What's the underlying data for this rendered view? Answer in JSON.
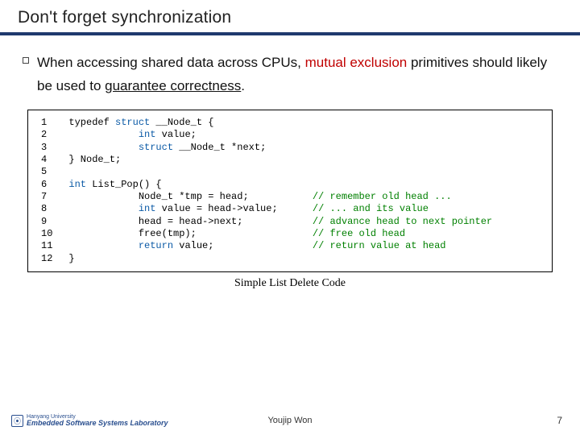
{
  "title": "Don't forget synchronization",
  "body": {
    "pre": "When accessing shared data across CPUs, ",
    "highlight": "mutual exclusion",
    "mid": " primitives should likely be used to ",
    "underline": "guarantee correctness",
    "post": "."
  },
  "code": {
    "linenos": "1\n2\n3\n4\n5\n6\n7\n8\n9\n10\n11\n12",
    "lines": [
      {
        "t": "typedef ",
        "kw": "struct",
        "t2": " __Node_t {"
      },
      {
        "ind": "            ",
        "kw": "int",
        "t2": " value;"
      },
      {
        "ind": "            ",
        "kw": "struct",
        "t2": " __Node_t *next;"
      },
      {
        "t": "} Node_t;"
      },
      {
        "t": ""
      },
      {
        "kw": "int",
        "t2": " List_Pop() {"
      },
      {
        "ind": "            ",
        "t": "Node_t *tmp = head;           ",
        "cm": "// remember old head ..."
      },
      {
        "ind": "            ",
        "kw": "int",
        "t2": " value = head->value;      ",
        "cm": "// ... and its value"
      },
      {
        "ind": "            ",
        "t": "head = head->next;            ",
        "cm": "// advance head to next pointer"
      },
      {
        "ind": "            ",
        "t": "free(tmp);                    ",
        "cm": "// free old head"
      },
      {
        "ind": "            ",
        "kw": "return",
        "t2": " value;                 ",
        "cm": "// return value at head"
      },
      {
        "t": "}"
      }
    ]
  },
  "caption": "Simple List Delete Code",
  "footer": {
    "logo_top": "Hanyang University",
    "logo_bottom": "Embedded Software Systems Laboratory",
    "center": "Youjip Won",
    "page": "7"
  }
}
